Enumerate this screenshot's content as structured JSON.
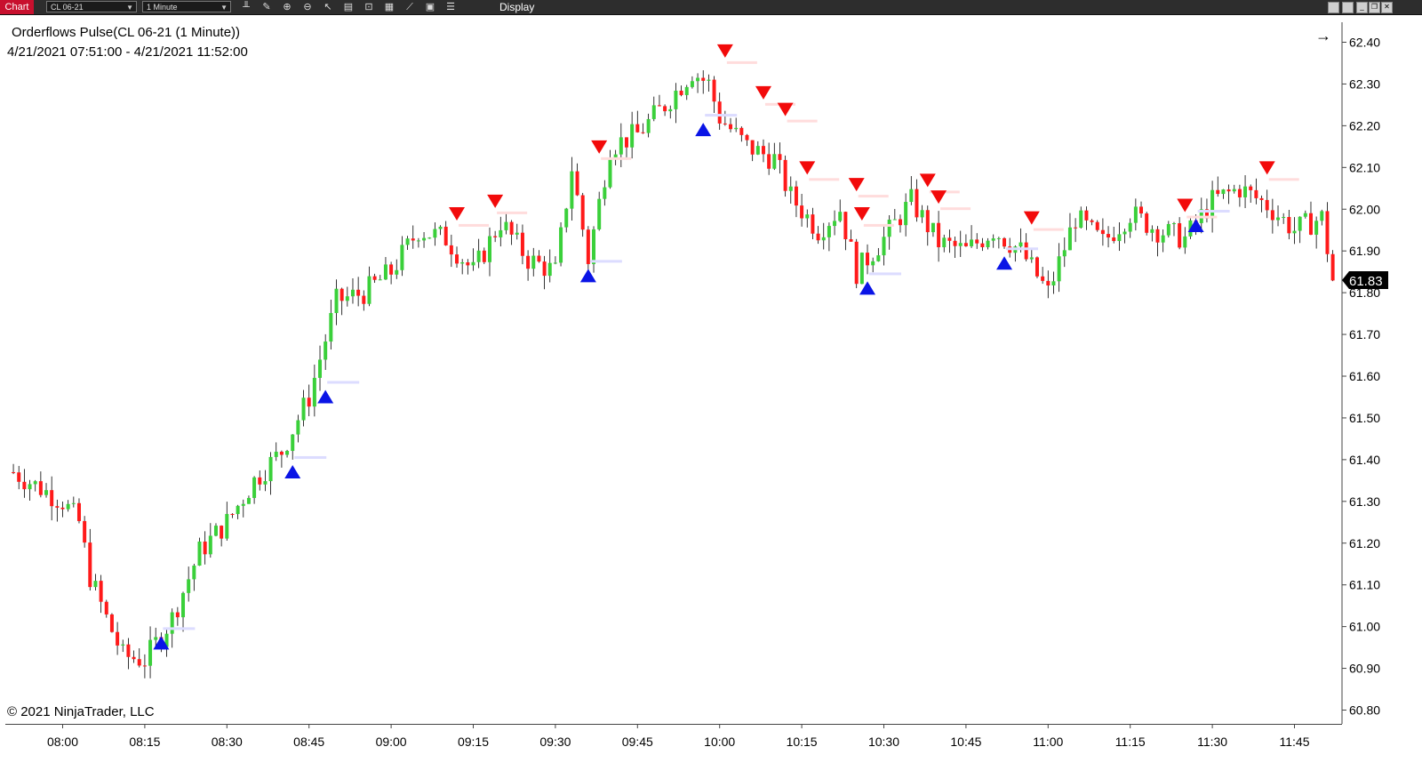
{
  "toolbar": {
    "tab_label": "Chart",
    "instrument": "CL 06-21",
    "interval": "1 Minute",
    "display_label": "Display",
    "icons": [
      "bars-icon",
      "draw-icon",
      "zoom-in-icon",
      "zoom-out-icon",
      "pointer-icon",
      "properties-icon",
      "data-box-icon",
      "templates-icon",
      "strategies-icon",
      "indicators-icon",
      "list-icon"
    ]
  },
  "header": {
    "title": "Orderflows Pulse(CL 06-21 (1 Minute))",
    "range": "4/21/2021 07:51:00 - 4/21/2021 11:52:00"
  },
  "footer": {
    "copyright": "© 2021 NinjaTrader, LLC"
  },
  "colors": {
    "up": "#3ad03a",
    "down": "#ff1a1a",
    "buy_marker": "#0a14e6",
    "sell_marker": "#f20a0a",
    "buy_line": "#dcdcff",
    "sell_line": "#ffdcdc",
    "price_tag_bg": "#000000"
  },
  "chart_data": {
    "type": "candlestick",
    "title": "Orderflows Pulse(CL 06-21 (1 Minute))",
    "xlabel": "",
    "ylabel": "",
    "x_tick_labels": [
      "08:00",
      "08:15",
      "08:30",
      "08:45",
      "09:00",
      "09:15",
      "09:30",
      "09:45",
      "10:00",
      "10:15",
      "10:30",
      "10:45",
      "11:00",
      "11:15",
      "11:30",
      "11:45"
    ],
    "y_tick_labels": [
      "62.40",
      "62.30",
      "62.20",
      "62.10",
      "62.00",
      "61.90",
      "61.80",
      "61.70",
      "61.60",
      "61.50",
      "61.40",
      "61.30",
      "61.20",
      "61.10",
      "61.00",
      "60.90",
      "60.80"
    ],
    "ylim": [
      60.8,
      62.4
    ],
    "last_price": "61.83",
    "close_path_sampled": [
      {
        "time": "07:51",
        "close": 61.37
      },
      {
        "time": "08:00",
        "close": 61.3
      },
      {
        "time": "08:03",
        "close": 61.25
      },
      {
        "time": "08:05",
        "close": 61.12
      },
      {
        "time": "08:08",
        "close": 61.02
      },
      {
        "time": "08:11",
        "close": 60.93
      },
      {
        "time": "08:15",
        "close": 60.92
      },
      {
        "time": "08:20",
        "close": 61.02
      },
      {
        "time": "08:25",
        "close": 61.18
      },
      {
        "time": "08:30",
        "close": 61.25
      },
      {
        "time": "08:35",
        "close": 61.35
      },
      {
        "time": "08:40",
        "close": 61.42
      },
      {
        "time": "08:45",
        "close": 61.55
      },
      {
        "time": "08:50",
        "close": 61.78
      },
      {
        "time": "08:55",
        "close": 61.8
      },
      {
        "time": "09:00",
        "close": 61.85
      },
      {
        "time": "09:05",
        "close": 61.95
      },
      {
        "time": "09:10",
        "close": 61.93
      },
      {
        "time": "09:15",
        "close": 61.85
      },
      {
        "time": "09:20",
        "close": 61.97
      },
      {
        "time": "09:25",
        "close": 61.88
      },
      {
        "time": "09:30",
        "close": 61.85
      },
      {
        "time": "09:33",
        "close": 62.1
      },
      {
        "time": "09:36",
        "close": 61.88
      },
      {
        "time": "09:40",
        "close": 62.15
      },
      {
        "time": "09:45",
        "close": 62.18
      },
      {
        "time": "09:50",
        "close": 62.25
      },
      {
        "time": "09:55",
        "close": 62.33
      },
      {
        "time": "09:58",
        "close": 62.3
      },
      {
        "time": "10:00",
        "close": 62.22
      },
      {
        "time": "10:05",
        "close": 62.15
      },
      {
        "time": "10:10",
        "close": 62.12
      },
      {
        "time": "10:13",
        "close": 62.03
      },
      {
        "time": "10:18",
        "close": 61.95
      },
      {
        "time": "10:22",
        "close": 62.0
      },
      {
        "time": "10:25",
        "close": 61.85
      },
      {
        "time": "10:30",
        "close": 61.93
      },
      {
        "time": "10:35",
        "close": 62.02
      },
      {
        "time": "10:40",
        "close": 61.92
      },
      {
        "time": "10:45",
        "close": 61.9
      },
      {
        "time": "10:50",
        "close": 61.95
      },
      {
        "time": "10:55",
        "close": 61.9
      },
      {
        "time": "11:00",
        "close": 61.8
      },
      {
        "time": "11:05",
        "close": 61.98
      },
      {
        "time": "11:10",
        "close": 61.92
      },
      {
        "time": "11:15",
        "close": 61.99
      },
      {
        "time": "11:20",
        "close": 61.95
      },
      {
        "time": "11:25",
        "close": 61.93
      },
      {
        "time": "11:30",
        "close": 62.02
      },
      {
        "time": "11:35",
        "close": 62.05
      },
      {
        "time": "11:40",
        "close": 62.01
      },
      {
        "time": "11:45",
        "close": 61.95
      },
      {
        "time": "11:50",
        "close": 61.98
      },
      {
        "time": "11:52",
        "close": 61.83
      }
    ],
    "buy_signals": [
      {
        "time": "08:18",
        "price": 60.96
      },
      {
        "time": "08:42",
        "price": 61.37
      },
      {
        "time": "08:48",
        "price": 61.55
      },
      {
        "time": "09:36",
        "price": 61.84
      },
      {
        "time": "09:57",
        "price": 62.19
      },
      {
        "time": "10:27",
        "price": 61.81
      },
      {
        "time": "10:52",
        "price": 61.87
      },
      {
        "time": "11:27",
        "price": 61.96
      }
    ],
    "sell_signals": [
      {
        "time": "09:12",
        "price": 61.99
      },
      {
        "time": "09:19",
        "price": 62.02
      },
      {
        "time": "09:38",
        "price": 62.15
      },
      {
        "time": "10:01",
        "price": 62.38
      },
      {
        "time": "10:08",
        "price": 62.28
      },
      {
        "time": "10:12",
        "price": 62.24
      },
      {
        "time": "10:16",
        "price": 62.1
      },
      {
        "time": "10:25",
        "price": 62.06
      },
      {
        "time": "10:26",
        "price": 61.99
      },
      {
        "time": "10:38",
        "price": 62.07
      },
      {
        "time": "10:40",
        "price": 62.03
      },
      {
        "time": "10:57",
        "price": 61.98
      },
      {
        "time": "11:25",
        "price": 62.01
      },
      {
        "time": "11:40",
        "price": 62.1
      }
    ]
  }
}
